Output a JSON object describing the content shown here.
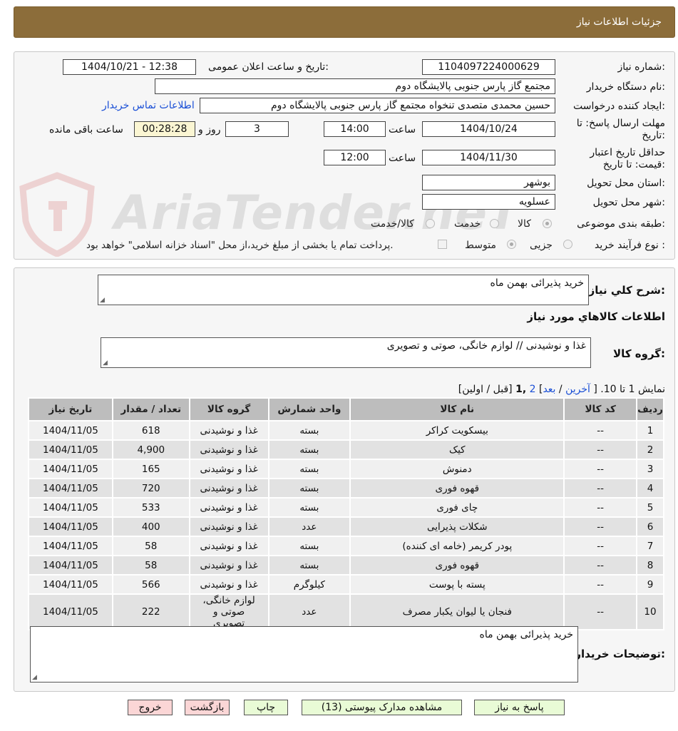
{
  "header": {
    "title": "جزئیات اطلاعات نیاز"
  },
  "watermark": {
    "text": "AriaTender.neT"
  },
  "form": {
    "need_number_label": "شماره نیاز:",
    "need_number": "1104097224000629",
    "announce_label": "تاریخ و ساعت اعلان عمومی:",
    "announce_value": "1404/10/21 - 12:38",
    "buyer_label": "نام دستگاه خریدار:",
    "buyer_value": "مجتمع گاز پارس جنوبی  پالایشگاه دوم",
    "creator_label": "ایجاد کننده درخواست:",
    "creator_value": "حسین محمدی متصدی تنخواه مجتمع گاز پارس جنوبی  پالایشگاه دوم",
    "contact_link": "اطلاعات تماس خریدار",
    "deadline_label": "مهلت ارسال پاسخ: تا تاریخ:",
    "deadline_date": "1404/10/24",
    "time_label": "ساعت",
    "deadline_time": "14:00",
    "days_value": "3",
    "days_label": "روز و",
    "remaining_value": "00:28:28",
    "remaining_label": "ساعت باقی مانده",
    "validity_label": "حداقل تاریخ اعتبار قیمت: تا تاریخ:",
    "validity_date": "1404/11/30",
    "validity_time": "12:00",
    "province_label": "استان محل تحویل:",
    "province_value": "بوشهر",
    "city_label": "شهر محل تحویل:",
    "city_value": "عسلویه",
    "category_label": "طبقه بندی موضوعی:",
    "category_options": [
      "کالا",
      "خدمت",
      "کالا/خدمت"
    ],
    "category_selected": "کالا",
    "process_label": "نوع فرآیند خرید :",
    "process_options": [
      "جزیی",
      "متوسط"
    ],
    "process_selected": "متوسط",
    "payment_note": "پرداخت تمام یا بخشی از مبلغ خرید،از محل \"اسناد خزانه اسلامی\" خواهد بود."
  },
  "summary": {
    "label": "شرح کلي نياز:",
    "value": "خرید پذیرائی بهمن ماه",
    "goods_info_title": "اطلاعات کالاهاي مورد نياز",
    "group_label": "گروه کالا:",
    "group_value": "غذا و نوشیدنی // لوازم خانگی، صوتی و تصویری"
  },
  "pagination": {
    "prefix": "نمایش 1 تا 10. [",
    "last": "آخرین",
    "sep1": "/",
    "next": "بعد",
    "after_next": "]",
    "page2": "2",
    "current": ",1",
    "tail": "[قبل / اولین]"
  },
  "table": {
    "headers": [
      "ردیف",
      "کد کالا",
      "نام کالا",
      "واحد شمارش",
      "گروه کالا",
      "تعداد / مقدار",
      "تاریخ نیاز"
    ],
    "rows": [
      [
        "1",
        "--",
        "بیسکویت کراکر",
        "بسته",
        "غذا و نوشیدنی",
        "618",
        "1404/11/05"
      ],
      [
        "2",
        "--",
        "کیک",
        "بسته",
        "غذا و نوشیدنی",
        "4,900",
        "1404/11/05"
      ],
      [
        "3",
        "--",
        "دمنوش",
        "بسته",
        "غذا و نوشیدنی",
        "165",
        "1404/11/05"
      ],
      [
        "4",
        "--",
        "قهوه فوری",
        "بسته",
        "غذا و نوشیدنی",
        "720",
        "1404/11/05"
      ],
      [
        "5",
        "--",
        "چای فوری",
        "بسته",
        "غذا و نوشیدنی",
        "533",
        "1404/11/05"
      ],
      [
        "6",
        "--",
        "شکلات پذیرایی",
        "عدد",
        "غذا و نوشیدنی",
        "400",
        "1404/11/05"
      ],
      [
        "7",
        "--",
        "پودر کریمر (خامه ای کننده)",
        "بسته",
        "غذا و نوشیدنی",
        "58",
        "1404/11/05"
      ],
      [
        "8",
        "--",
        "قهوه فوری",
        "بسته",
        "غذا و نوشیدنی",
        "58",
        "1404/11/05"
      ],
      [
        "9",
        "--",
        "پسته با پوست",
        "کیلوگرم",
        "غذا و نوشیدنی",
        "566",
        "1404/11/05"
      ],
      [
        "10",
        "--",
        "فنجان یا لیوان یکبار مصرف",
        "عدد",
        "لوازم خانگی، صوتی و تصویری",
        "222",
        "1404/11/05"
      ]
    ]
  },
  "buyer_notes": {
    "label": "توضیحات خریدار:",
    "value": "خرید پذیرائی بهمن ماه"
  },
  "buttons": {
    "respond": "پاسخ به نیاز",
    "attachments": "مشاهده مدارک پیوستی (13)",
    "print": "چاپ",
    "back": "بازگشت",
    "exit": "خروج"
  }
}
